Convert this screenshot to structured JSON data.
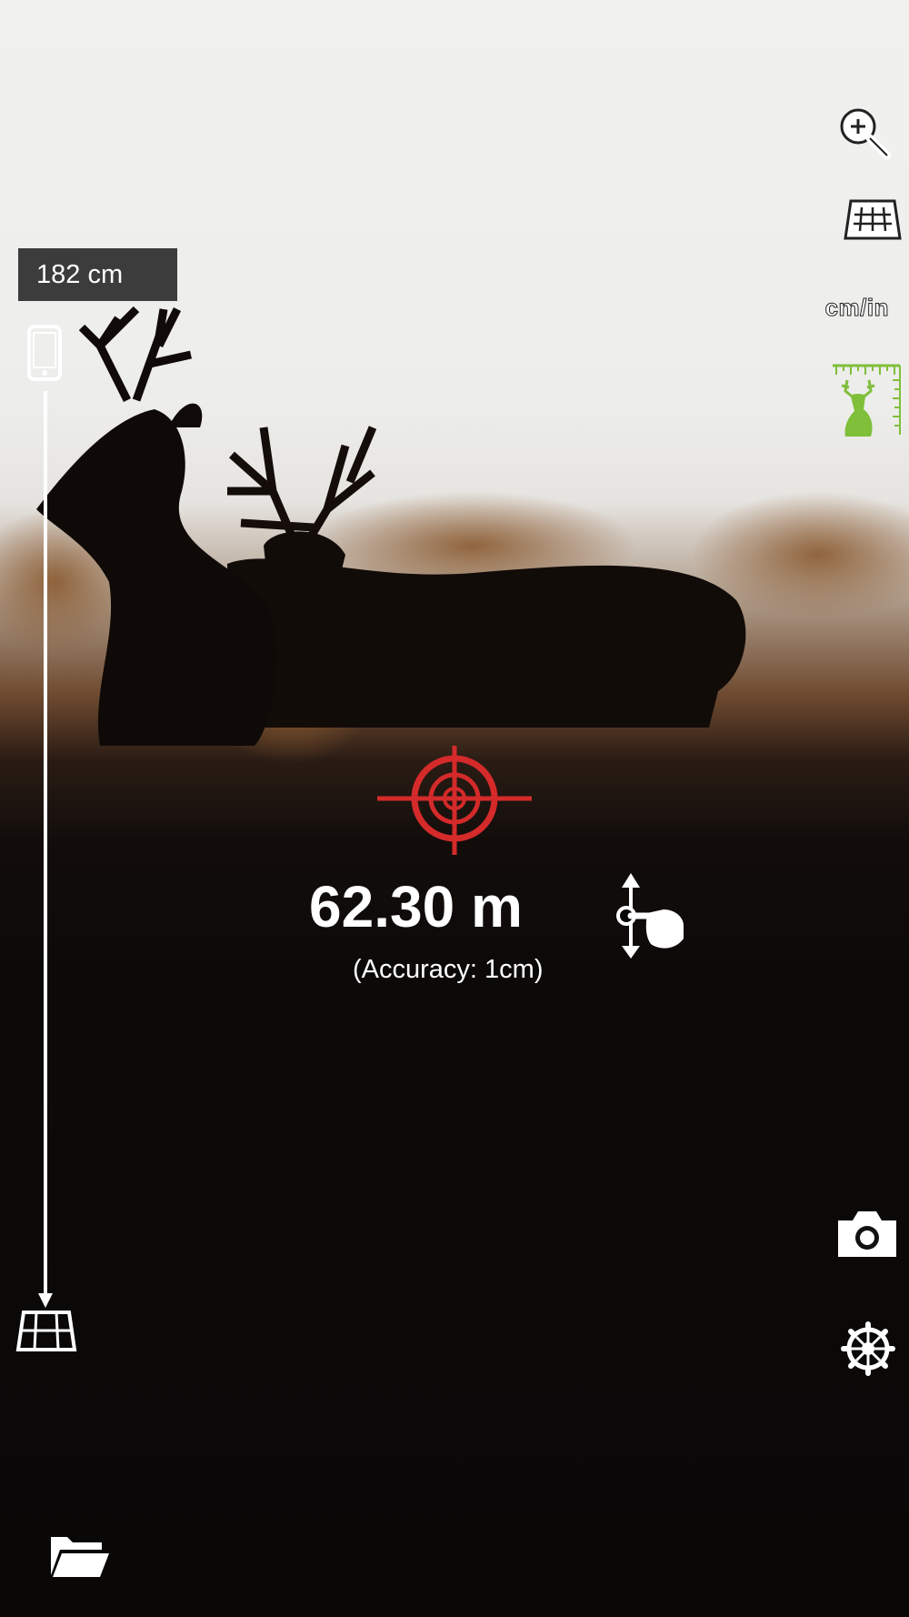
{
  "measurement": {
    "distance": "62.30 m",
    "accuracy": "(Accuracy: 1cm)",
    "camera_height": "182 cm"
  },
  "toolbar": {
    "unit_toggle_label": "cm/in"
  },
  "icons": {
    "zoom": "zoom-icon",
    "ground-plane": "ground-grid-icon",
    "target-size": "deer-ruler-icon",
    "camera": "camera-icon",
    "settings": "gear-icon",
    "folder": "folder-icon",
    "reticle": "crosshair-icon",
    "drag-hint": "drag-hand-icon",
    "phone": "phone-icon"
  },
  "colors": {
    "reticle": "#d42a2a",
    "deer_icon": "#7fbf3a",
    "badge_bg": "#3c3c3c"
  }
}
